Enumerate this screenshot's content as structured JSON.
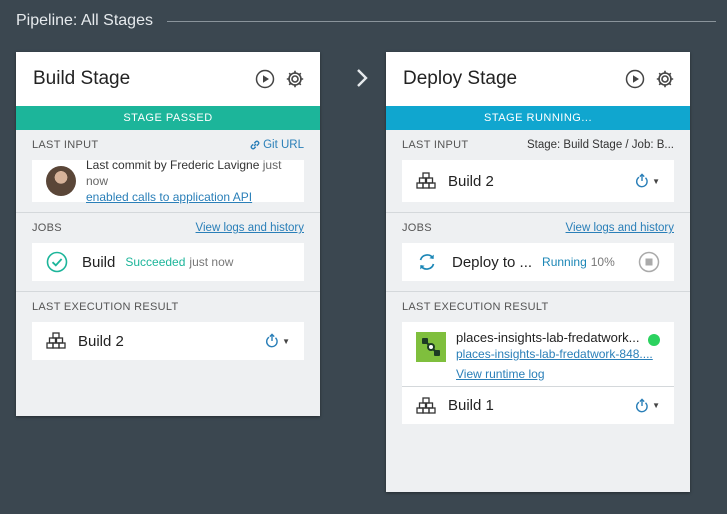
{
  "pipeline": {
    "title": "Pipeline: All Stages"
  },
  "colors": {
    "passed": "#1cb59a",
    "running": "#10a6cf",
    "background": "#3b4750",
    "link": "#2a7fb8",
    "app_status": "#2bd25f"
  },
  "build_stage": {
    "title": "Build Stage",
    "status": "STAGE PASSED",
    "last_input": {
      "heading": "LAST INPUT",
      "link": "Git URL",
      "commit_prefix": "Last commit by Frederic Lavigne",
      "commit_time": "just now",
      "commit_message": "enabled calls to application API"
    },
    "jobs": {
      "heading": "JOBS",
      "link": "View logs and history",
      "job_name": "Build",
      "job_status": "Succeeded",
      "job_time": "just now"
    },
    "last_execution": {
      "heading": "LAST EXECUTION RESULT",
      "build": "Build 2"
    }
  },
  "deploy_stage": {
    "title": "Deploy Stage",
    "status": "STAGE RUNNING...",
    "last_input": {
      "heading": "LAST INPUT",
      "meta": "Stage: Build Stage  /  Job: B...",
      "build": "Build 2"
    },
    "jobs": {
      "heading": "JOBS",
      "link": "View logs and history",
      "job_name": "Deploy to ...",
      "job_status": "Running",
      "job_progress": "10%"
    },
    "last_execution": {
      "heading": "LAST EXECUTION RESULT",
      "app_name": "places-insights-lab-fredatwork...",
      "app_url": "places-insights-lab-fredatwork-848....",
      "runtime_log": "View runtime log",
      "build": "Build 1"
    }
  },
  "icons": [
    "play-icon",
    "gear-icon",
    "link-icon",
    "build-stack-icon",
    "check-circle-icon",
    "refresh-icon",
    "stop-icon",
    "redeploy-icon",
    "chevron-right-icon",
    "app-logo-icon"
  ]
}
